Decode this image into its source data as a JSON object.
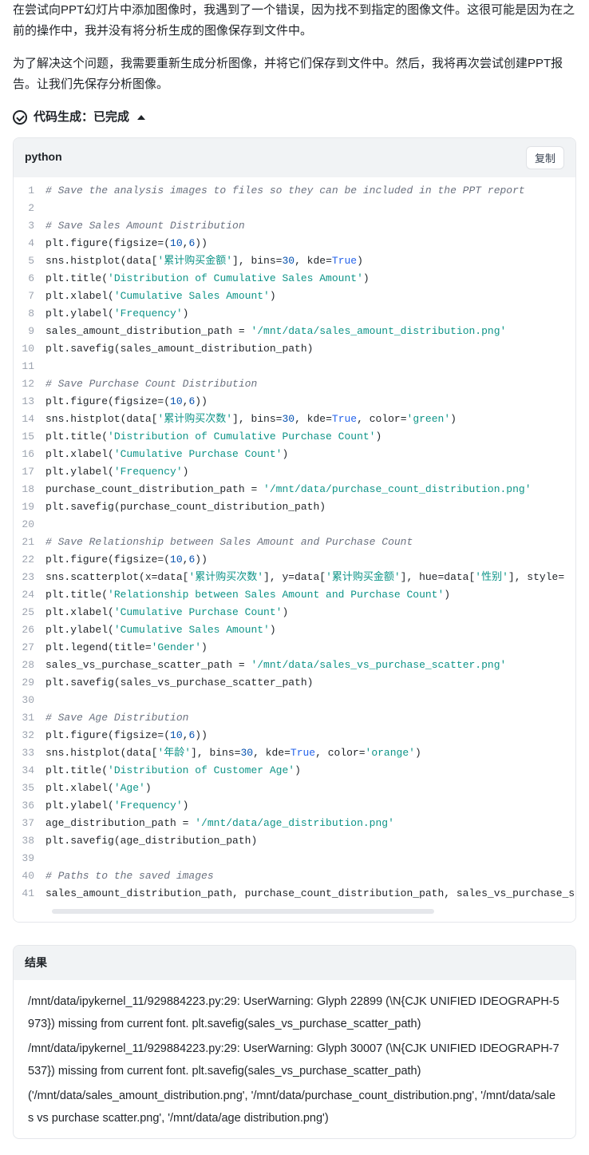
{
  "intro": {
    "p1": "在尝试向PPT幻灯片中添加图像时，我遇到了一个错误，因为找不到指定的图像文件。这很可能是因为在之前的操作中，我并没有将分析生成的图像保存到文件中。",
    "p2": "为了解决这个问题，我需要重新生成分析图像，并将它们保存到文件中。然后，我将再次尝试创建PPT报告。让我们先保存分析图像。"
  },
  "codegen": {
    "label": "代码生成：已完成"
  },
  "code": {
    "lang": "python",
    "copy": "复制",
    "lines": [
      {
        "n": 1,
        "t": [
          [
            "cm",
            "# Save the analysis images to files so they can be included in the PPT report"
          ]
        ]
      },
      {
        "n": 2,
        "t": []
      },
      {
        "n": 3,
        "t": [
          [
            "cm",
            "# Save Sales Amount Distribution"
          ]
        ]
      },
      {
        "n": 4,
        "t": [
          [
            "fn",
            "plt.figure(figsize=("
          ],
          [
            "nu",
            "10"
          ],
          [
            "pu",
            ","
          ],
          [
            "nu",
            "6"
          ],
          [
            "fn",
            "))"
          ]
        ]
      },
      {
        "n": 5,
        "t": [
          [
            "fn",
            "sns.histplot(data["
          ],
          [
            "st",
            "'累计购买金额'"
          ],
          [
            "fn",
            "], bins="
          ],
          [
            "nu",
            "30"
          ],
          [
            "fn",
            ", kde="
          ],
          [
            "kw",
            "True"
          ],
          [
            "fn",
            ")"
          ]
        ]
      },
      {
        "n": 6,
        "t": [
          [
            "fn",
            "plt.title("
          ],
          [
            "st",
            "'Distribution of Cumulative Sales Amount'"
          ],
          [
            "fn",
            ")"
          ]
        ]
      },
      {
        "n": 7,
        "t": [
          [
            "fn",
            "plt.xlabel("
          ],
          [
            "st",
            "'Cumulative Sales Amount'"
          ],
          [
            "fn",
            ")"
          ]
        ]
      },
      {
        "n": 8,
        "t": [
          [
            "fn",
            "plt.ylabel("
          ],
          [
            "st",
            "'Frequency'"
          ],
          [
            "fn",
            ")"
          ]
        ]
      },
      {
        "n": 9,
        "t": [
          [
            "fn",
            "sales_amount_distribution_path = "
          ],
          [
            "st",
            "'/mnt/data/sales_amount_distribution.png'"
          ]
        ]
      },
      {
        "n": 10,
        "t": [
          [
            "fn",
            "plt.savefig(sales_amount_distribution_path)"
          ]
        ]
      },
      {
        "n": 11,
        "t": []
      },
      {
        "n": 12,
        "t": [
          [
            "cm",
            "# Save Purchase Count Distribution"
          ]
        ]
      },
      {
        "n": 13,
        "t": [
          [
            "fn",
            "plt.figure(figsize=("
          ],
          [
            "nu",
            "10"
          ],
          [
            "pu",
            ","
          ],
          [
            "nu",
            "6"
          ],
          [
            "fn",
            "))"
          ]
        ]
      },
      {
        "n": 14,
        "t": [
          [
            "fn",
            "sns.histplot(data["
          ],
          [
            "st",
            "'累计购买次数'"
          ],
          [
            "fn",
            "], bins="
          ],
          [
            "nu",
            "30"
          ],
          [
            "fn",
            ", kde="
          ],
          [
            "kw",
            "True"
          ],
          [
            "fn",
            ", color="
          ],
          [
            "st",
            "'green'"
          ],
          [
            "fn",
            ")"
          ]
        ]
      },
      {
        "n": 15,
        "t": [
          [
            "fn",
            "plt.title("
          ],
          [
            "st",
            "'Distribution of Cumulative Purchase Count'"
          ],
          [
            "fn",
            ")"
          ]
        ]
      },
      {
        "n": 16,
        "t": [
          [
            "fn",
            "plt.xlabel("
          ],
          [
            "st",
            "'Cumulative Purchase Count'"
          ],
          [
            "fn",
            ")"
          ]
        ]
      },
      {
        "n": 17,
        "t": [
          [
            "fn",
            "plt.ylabel("
          ],
          [
            "st",
            "'Frequency'"
          ],
          [
            "fn",
            ")"
          ]
        ]
      },
      {
        "n": 18,
        "t": [
          [
            "fn",
            "purchase_count_distribution_path = "
          ],
          [
            "st",
            "'/mnt/data/purchase_count_distribution.png'"
          ]
        ]
      },
      {
        "n": 19,
        "t": [
          [
            "fn",
            "plt.savefig(purchase_count_distribution_path)"
          ]
        ]
      },
      {
        "n": 20,
        "t": []
      },
      {
        "n": 21,
        "t": [
          [
            "cm",
            "# Save Relationship between Sales Amount and Purchase Count"
          ]
        ]
      },
      {
        "n": 22,
        "t": [
          [
            "fn",
            "plt.figure(figsize=("
          ],
          [
            "nu",
            "10"
          ],
          [
            "pu",
            ","
          ],
          [
            "nu",
            "6"
          ],
          [
            "fn",
            "))"
          ]
        ]
      },
      {
        "n": 23,
        "t": [
          [
            "fn",
            "sns.scatterplot(x=data["
          ],
          [
            "st",
            "'累计购买次数'"
          ],
          [
            "fn",
            "], y=data["
          ],
          [
            "st",
            "'累计购买金额'"
          ],
          [
            "fn",
            "], hue=data["
          ],
          [
            "st",
            "'性别'"
          ],
          [
            "fn",
            "], style="
          ]
        ]
      },
      {
        "n": 24,
        "t": [
          [
            "fn",
            "plt.title("
          ],
          [
            "st",
            "'Relationship between Sales Amount and Purchase Count'"
          ],
          [
            "fn",
            ")"
          ]
        ]
      },
      {
        "n": 25,
        "t": [
          [
            "fn",
            "plt.xlabel("
          ],
          [
            "st",
            "'Cumulative Purchase Count'"
          ],
          [
            "fn",
            ")"
          ]
        ]
      },
      {
        "n": 26,
        "t": [
          [
            "fn",
            "plt.ylabel("
          ],
          [
            "st",
            "'Cumulative Sales Amount'"
          ],
          [
            "fn",
            ")"
          ]
        ]
      },
      {
        "n": 27,
        "t": [
          [
            "fn",
            "plt.legend(title="
          ],
          [
            "st",
            "'Gender'"
          ],
          [
            "fn",
            ")"
          ]
        ]
      },
      {
        "n": 28,
        "t": [
          [
            "fn",
            "sales_vs_purchase_scatter_path = "
          ],
          [
            "st",
            "'/mnt/data/sales_vs_purchase_scatter.png'"
          ]
        ]
      },
      {
        "n": 29,
        "t": [
          [
            "fn",
            "plt.savefig(sales_vs_purchase_scatter_path)"
          ]
        ]
      },
      {
        "n": 30,
        "t": []
      },
      {
        "n": 31,
        "t": [
          [
            "cm",
            "# Save Age Distribution"
          ]
        ]
      },
      {
        "n": 32,
        "t": [
          [
            "fn",
            "plt.figure(figsize=("
          ],
          [
            "nu",
            "10"
          ],
          [
            "pu",
            ","
          ],
          [
            "nu",
            "6"
          ],
          [
            "fn",
            "))"
          ]
        ]
      },
      {
        "n": 33,
        "t": [
          [
            "fn",
            "sns.histplot(data["
          ],
          [
            "st",
            "'年龄'"
          ],
          [
            "fn",
            "], bins="
          ],
          [
            "nu",
            "30"
          ],
          [
            "fn",
            ", kde="
          ],
          [
            "kw",
            "True"
          ],
          [
            "fn",
            ", color="
          ],
          [
            "st",
            "'orange'"
          ],
          [
            "fn",
            ")"
          ]
        ]
      },
      {
        "n": 34,
        "t": [
          [
            "fn",
            "plt.title("
          ],
          [
            "st",
            "'Distribution of Customer Age'"
          ],
          [
            "fn",
            ")"
          ]
        ]
      },
      {
        "n": 35,
        "t": [
          [
            "fn",
            "plt.xlabel("
          ],
          [
            "st",
            "'Age'"
          ],
          [
            "fn",
            ")"
          ]
        ]
      },
      {
        "n": 36,
        "t": [
          [
            "fn",
            "plt.ylabel("
          ],
          [
            "st",
            "'Frequency'"
          ],
          [
            "fn",
            ")"
          ]
        ]
      },
      {
        "n": 37,
        "t": [
          [
            "fn",
            "age_distribution_path = "
          ],
          [
            "st",
            "'/mnt/data/age_distribution.png'"
          ]
        ]
      },
      {
        "n": 38,
        "t": [
          [
            "fn",
            "plt.savefig(age_distribution_path)"
          ]
        ]
      },
      {
        "n": 39,
        "t": []
      },
      {
        "n": 40,
        "t": [
          [
            "cm",
            "# Paths to the saved images"
          ]
        ]
      },
      {
        "n": 41,
        "t": [
          [
            "fn",
            "sales_amount_distribution_path, purchase_count_distribution_path, sales_vs_purchase_s"
          ]
        ]
      }
    ]
  },
  "result": {
    "title": "结果",
    "lines": [
      "/mnt/data/ipykernel_11/929884223.py:29: UserWarning: Glyph 22899 (\\N{CJK UNIFIED IDEOGRAPH-5973}) missing from current font. plt.savefig(sales_vs_purchase_scatter_path)",
      "/mnt/data/ipykernel_11/929884223.py:29: UserWarning: Glyph 30007 (\\N{CJK UNIFIED IDEOGRAPH-7537}) missing from current font. plt.savefig(sales_vs_purchase_scatter_path)",
      "('/mnt/data/sales_amount_distribution.png', '/mnt/data/purchase_count_distribution.png', '/mnt/data/sales vs purchase scatter.png', '/mnt/data/age distribution.png')"
    ]
  }
}
